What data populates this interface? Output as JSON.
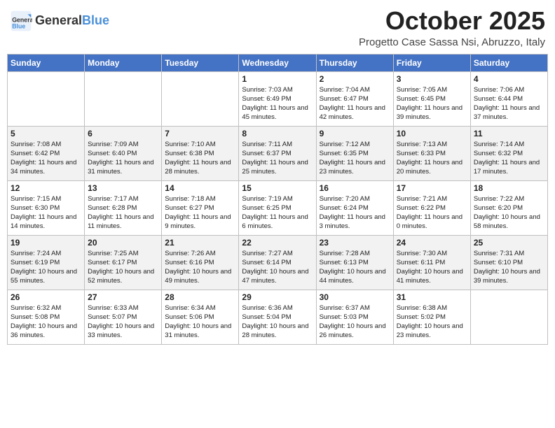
{
  "header": {
    "logo_general": "General",
    "logo_blue": "Blue",
    "month_title": "October 2025",
    "subtitle": "Progetto Case Sassa Nsi, Abruzzo, Italy"
  },
  "days_of_week": [
    "Sunday",
    "Monday",
    "Tuesday",
    "Wednesday",
    "Thursday",
    "Friday",
    "Saturday"
  ],
  "weeks": [
    [
      {
        "day": "",
        "info": ""
      },
      {
        "day": "",
        "info": ""
      },
      {
        "day": "",
        "info": ""
      },
      {
        "day": "1",
        "info": "Sunrise: 7:03 AM\nSunset: 6:49 PM\nDaylight: 11 hours and 45 minutes."
      },
      {
        "day": "2",
        "info": "Sunrise: 7:04 AM\nSunset: 6:47 PM\nDaylight: 11 hours and 42 minutes."
      },
      {
        "day": "3",
        "info": "Sunrise: 7:05 AM\nSunset: 6:45 PM\nDaylight: 11 hours and 39 minutes."
      },
      {
        "day": "4",
        "info": "Sunrise: 7:06 AM\nSunset: 6:44 PM\nDaylight: 11 hours and 37 minutes."
      }
    ],
    [
      {
        "day": "5",
        "info": "Sunrise: 7:08 AM\nSunset: 6:42 PM\nDaylight: 11 hours and 34 minutes."
      },
      {
        "day": "6",
        "info": "Sunrise: 7:09 AM\nSunset: 6:40 PM\nDaylight: 11 hours and 31 minutes."
      },
      {
        "day": "7",
        "info": "Sunrise: 7:10 AM\nSunset: 6:38 PM\nDaylight: 11 hours and 28 minutes."
      },
      {
        "day": "8",
        "info": "Sunrise: 7:11 AM\nSunset: 6:37 PM\nDaylight: 11 hours and 25 minutes."
      },
      {
        "day": "9",
        "info": "Sunrise: 7:12 AM\nSunset: 6:35 PM\nDaylight: 11 hours and 23 minutes."
      },
      {
        "day": "10",
        "info": "Sunrise: 7:13 AM\nSunset: 6:33 PM\nDaylight: 11 hours and 20 minutes."
      },
      {
        "day": "11",
        "info": "Sunrise: 7:14 AM\nSunset: 6:32 PM\nDaylight: 11 hours and 17 minutes."
      }
    ],
    [
      {
        "day": "12",
        "info": "Sunrise: 7:15 AM\nSunset: 6:30 PM\nDaylight: 11 hours and 14 minutes."
      },
      {
        "day": "13",
        "info": "Sunrise: 7:17 AM\nSunset: 6:28 PM\nDaylight: 11 hours and 11 minutes."
      },
      {
        "day": "14",
        "info": "Sunrise: 7:18 AM\nSunset: 6:27 PM\nDaylight: 11 hours and 9 minutes."
      },
      {
        "day": "15",
        "info": "Sunrise: 7:19 AM\nSunset: 6:25 PM\nDaylight: 11 hours and 6 minutes."
      },
      {
        "day": "16",
        "info": "Sunrise: 7:20 AM\nSunset: 6:24 PM\nDaylight: 11 hours and 3 minutes."
      },
      {
        "day": "17",
        "info": "Sunrise: 7:21 AM\nSunset: 6:22 PM\nDaylight: 11 hours and 0 minutes."
      },
      {
        "day": "18",
        "info": "Sunrise: 7:22 AM\nSunset: 6:20 PM\nDaylight: 10 hours and 58 minutes."
      }
    ],
    [
      {
        "day": "19",
        "info": "Sunrise: 7:24 AM\nSunset: 6:19 PM\nDaylight: 10 hours and 55 minutes."
      },
      {
        "day": "20",
        "info": "Sunrise: 7:25 AM\nSunset: 6:17 PM\nDaylight: 10 hours and 52 minutes."
      },
      {
        "day": "21",
        "info": "Sunrise: 7:26 AM\nSunset: 6:16 PM\nDaylight: 10 hours and 49 minutes."
      },
      {
        "day": "22",
        "info": "Sunrise: 7:27 AM\nSunset: 6:14 PM\nDaylight: 10 hours and 47 minutes."
      },
      {
        "day": "23",
        "info": "Sunrise: 7:28 AM\nSunset: 6:13 PM\nDaylight: 10 hours and 44 minutes."
      },
      {
        "day": "24",
        "info": "Sunrise: 7:30 AM\nSunset: 6:11 PM\nDaylight: 10 hours and 41 minutes."
      },
      {
        "day": "25",
        "info": "Sunrise: 7:31 AM\nSunset: 6:10 PM\nDaylight: 10 hours and 39 minutes."
      }
    ],
    [
      {
        "day": "26",
        "info": "Sunrise: 6:32 AM\nSunset: 5:08 PM\nDaylight: 10 hours and 36 minutes."
      },
      {
        "day": "27",
        "info": "Sunrise: 6:33 AM\nSunset: 5:07 PM\nDaylight: 10 hours and 33 minutes."
      },
      {
        "day": "28",
        "info": "Sunrise: 6:34 AM\nSunset: 5:06 PM\nDaylight: 10 hours and 31 minutes."
      },
      {
        "day": "29",
        "info": "Sunrise: 6:36 AM\nSunset: 5:04 PM\nDaylight: 10 hours and 28 minutes."
      },
      {
        "day": "30",
        "info": "Sunrise: 6:37 AM\nSunset: 5:03 PM\nDaylight: 10 hours and 26 minutes."
      },
      {
        "day": "31",
        "info": "Sunrise: 6:38 AM\nSunset: 5:02 PM\nDaylight: 10 hours and 23 minutes."
      },
      {
        "day": "",
        "info": ""
      }
    ]
  ]
}
